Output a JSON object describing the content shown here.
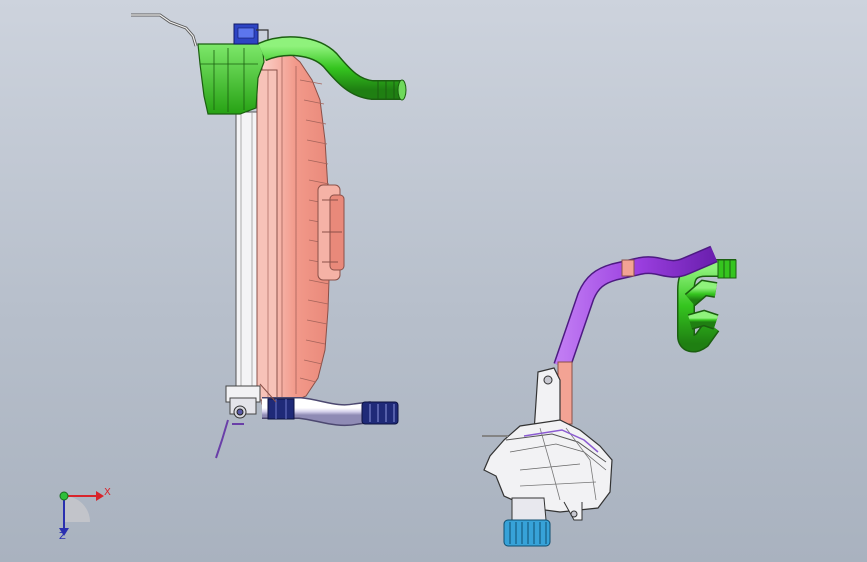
{
  "viewport": {
    "background_top": "#cdd3dd",
    "background_bottom": "#a9b2bf"
  },
  "triad": {
    "x_label": "X",
    "y_label": "Z",
    "x_color": "#d8242b",
    "y_color": "#2a2fb0",
    "origin_color": "#2fbf3a"
  },
  "colors": {
    "radiator_shroud": "#f3a394",
    "shroud_edge": "#8a5048",
    "green_part": "#35c51f",
    "purple_hose": "#9b3fe0",
    "lavender_hose": "#d6d2ec",
    "navy_clamp": "#1f2a78",
    "white_part": "#f2f2f4",
    "cyan_cap": "#37a2d8"
  }
}
